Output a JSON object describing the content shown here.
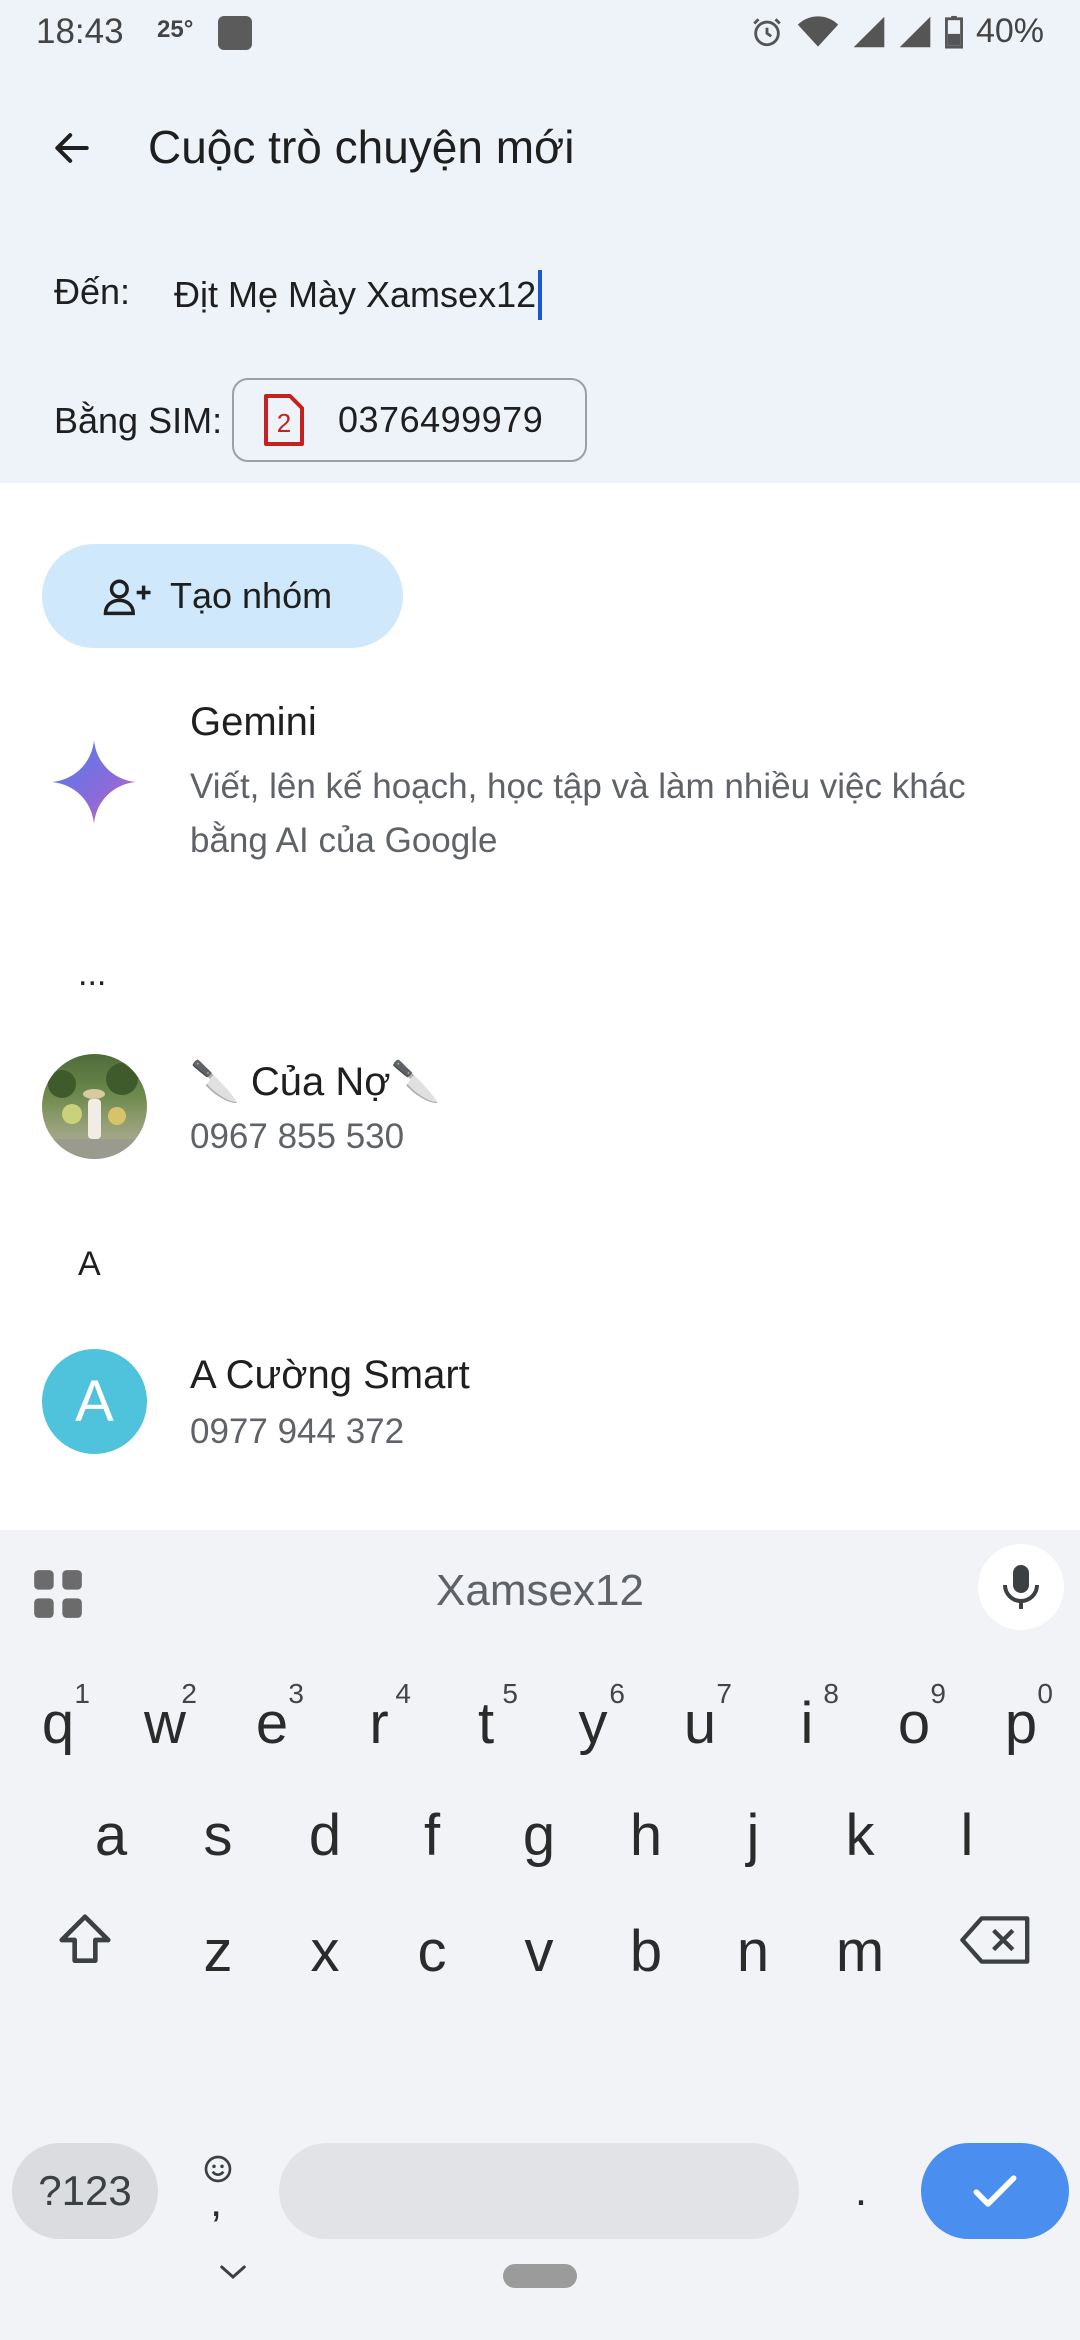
{
  "status_bar": {
    "time": "18:43",
    "temperature": "25°",
    "battery": "40%"
  },
  "header": {
    "title": "Cuộc trò chuyện mới"
  },
  "recipient": {
    "label": "Đến:",
    "value": "Địt Mẹ Mày Xamsex12"
  },
  "sim": {
    "label": "Bằng SIM:",
    "sim_slot": "2",
    "number": "0376499979"
  },
  "group_button": {
    "label": "Tạo nhóm"
  },
  "suggestions": [
    {
      "name": "Gemini",
      "desc": "Viết, lên kế hoạch, học tập và làm nhiều việc khác bằng AI của Google"
    }
  ],
  "sections": {
    "dots": "...",
    "a": "A"
  },
  "contacts": [
    {
      "name": "🔪 Của Nợ🔪",
      "phone": "0967 855 530"
    },
    {
      "name": "A Cường Smart",
      "phone": "0977 944 372",
      "initial": "A",
      "avatar_color": "#4fc3dc"
    }
  ],
  "keyboard": {
    "suggestion_word": "Xamsex12",
    "row1": [
      {
        "k": "q",
        "h": "1"
      },
      {
        "k": "w",
        "h": "2"
      },
      {
        "k": "e",
        "h": "3"
      },
      {
        "k": "r",
        "h": "4"
      },
      {
        "k": "t",
        "h": "5"
      },
      {
        "k": "y",
        "h": "6"
      },
      {
        "k": "u",
        "h": "7"
      },
      {
        "k": "i",
        "h": "8"
      },
      {
        "k": "o",
        "h": "9"
      },
      {
        "k": "p",
        "h": "0"
      }
    ],
    "row2": [
      "a",
      "s",
      "d",
      "f",
      "g",
      "h",
      "j",
      "k",
      "l"
    ],
    "row3": [
      "z",
      "x",
      "c",
      "v",
      "b",
      "n",
      "m"
    ],
    "sym_label": "?123",
    "comma": ",",
    "period": ".",
    "enter_color": "#4a8ef0"
  }
}
